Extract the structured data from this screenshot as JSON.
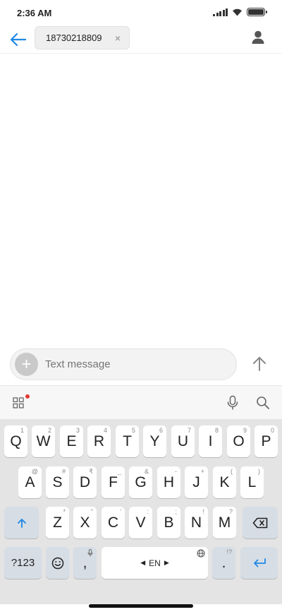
{
  "status_bar": {
    "time": "2:36 AM"
  },
  "header": {
    "recipient": "18730218809",
    "remove_symbol": "×"
  },
  "compose": {
    "placeholder": "Text message",
    "add_symbol": "+"
  },
  "keyboard": {
    "row1": [
      {
        "label": "Q",
        "sup": "1"
      },
      {
        "label": "W",
        "sup": "2"
      },
      {
        "label": "E",
        "sup": "3"
      },
      {
        "label": "R",
        "sup": "4"
      },
      {
        "label": "T",
        "sup": "5"
      },
      {
        "label": "Y",
        "sup": "6"
      },
      {
        "label": "U",
        "sup": "7"
      },
      {
        "label": "I",
        "sup": "8"
      },
      {
        "label": "O",
        "sup": "9"
      },
      {
        "label": "P",
        "sup": "0"
      }
    ],
    "row2": [
      {
        "label": "A",
        "sup": "@"
      },
      {
        "label": "S",
        "sup": "#"
      },
      {
        "label": "D",
        "sup": "₹"
      },
      {
        "label": "F",
        "sup": "_"
      },
      {
        "label": "G",
        "sup": "&"
      },
      {
        "label": "H",
        "sup": "-"
      },
      {
        "label": "J",
        "sup": "+"
      },
      {
        "label": "K",
        "sup": "("
      },
      {
        "label": "L",
        "sup": ")"
      }
    ],
    "row3": [
      {
        "label": "Z",
        "sup": "*"
      },
      {
        "label": "X",
        "sup": "\""
      },
      {
        "label": "C",
        "sup": "'"
      },
      {
        "label": "V",
        "sup": ":"
      },
      {
        "label": "B",
        "sup": ";"
      },
      {
        "label": "N",
        "sup": "!"
      },
      {
        "label": "M",
        "sup": "?"
      }
    ],
    "symbols_label": "?123",
    "comma_label": ",",
    "space_label": "EN",
    "period_label": ".",
    "period_sup": "!?"
  },
  "icons": {
    "back": "back-arrow-icon",
    "contact": "person-icon",
    "send": "send-arrow-icon",
    "grid": "grid-icon",
    "mic": "microphone-icon",
    "search": "search-icon",
    "shift": "shift-icon",
    "backspace": "backspace-icon",
    "emoji": "emoji-icon",
    "globe": "globe-icon",
    "enter": "enter-icon"
  },
  "colors": {
    "accent": "#1e88e5",
    "keyboard_bg": "#e4e4e4",
    "key_bg": "#ffffff",
    "function_key_bg": "#d6dde5",
    "notification_dot": "#e53935"
  }
}
